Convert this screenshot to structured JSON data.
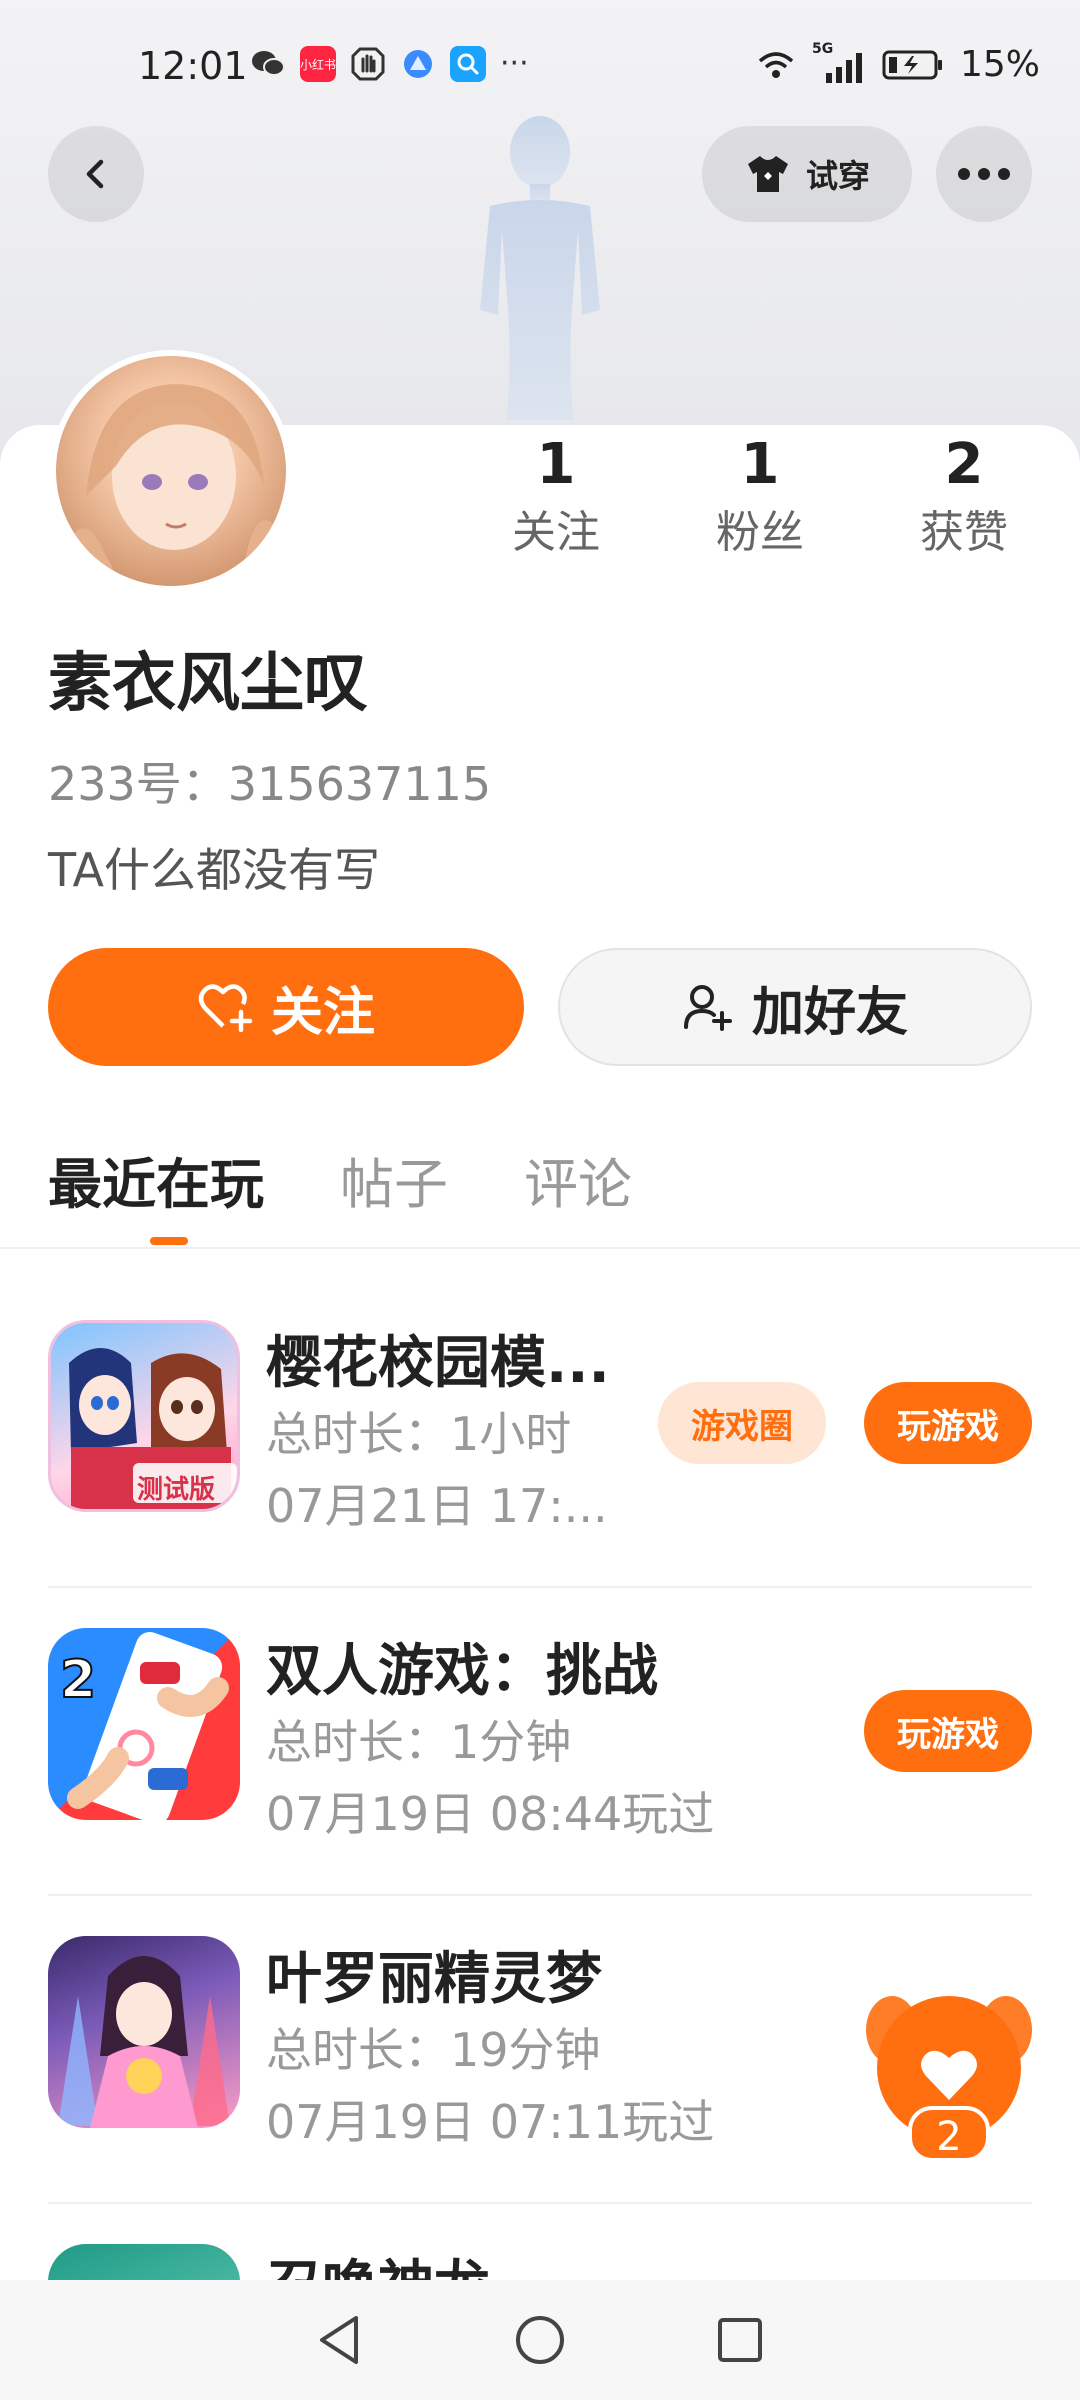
{
  "status_bar": {
    "time": "12:01",
    "battery": "15%",
    "network": "5G",
    "notification_icons": [
      "wechat-icon",
      "xiaohongshu-icon",
      "hand-icon",
      "browser-icon",
      "search-app-icon"
    ],
    "more": "···",
    "xiaohongshu_label": "小红书"
  },
  "header": {
    "tryon_label": "试穿"
  },
  "stats": [
    {
      "num": "1",
      "label": "关注"
    },
    {
      "num": "1",
      "label": "粉丝"
    },
    {
      "num": "2",
      "label": "获赞"
    }
  ],
  "profile": {
    "name": "素衣风尘叹",
    "id_text": "233号：315637115",
    "bio": "TA什么都没有写"
  },
  "actions": {
    "follow_label": "关注",
    "add_friend_label": "加好友"
  },
  "tabs": [
    {
      "label": "最近在玩",
      "active": true
    },
    {
      "label": "帖子",
      "active": false
    },
    {
      "label": "评论",
      "active": false
    }
  ],
  "games": [
    {
      "title": "樱花校园模...",
      "duration": "总时长：1小时",
      "time": "07月21日 17:...",
      "circle_label": "游戏圈",
      "play_label": "玩游戏",
      "icon_text": "测试版"
    },
    {
      "title": "双人游戏：挑战",
      "duration": "总时长：1分钟",
      "time": "07月19日 08:44玩过",
      "play_label": "玩游戏",
      "icon_text": "2"
    },
    {
      "title": "叶罗丽精灵梦",
      "duration": "总时长：19分钟",
      "time": "07月19日 07:11玩过"
    },
    {
      "title": "召唤神龙"
    }
  ],
  "floating_like": {
    "count": "2"
  },
  "colors": {
    "accent": "#ff6f10",
    "accent_light": "#ffe5d4"
  }
}
